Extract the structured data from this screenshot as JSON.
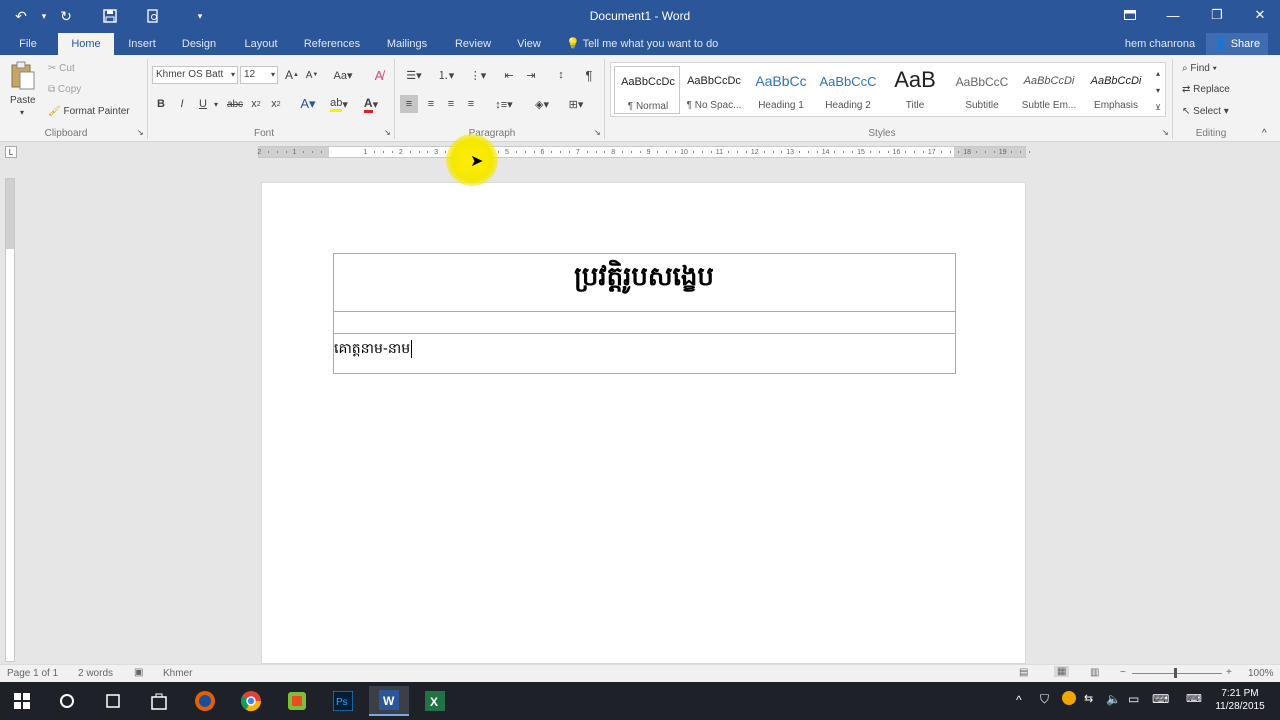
{
  "app": {
    "title": "Document1 - Word"
  },
  "tabs": [
    {
      "label": "File"
    },
    {
      "label": "Home"
    },
    {
      "label": "Insert"
    },
    {
      "label": "Design"
    },
    {
      "label": "Layout"
    },
    {
      "label": "References"
    },
    {
      "label": "Mailings"
    },
    {
      "label": "Review"
    },
    {
      "label": "View"
    }
  ],
  "tell_me": "Tell me what you want to do",
  "user": {
    "name": "hem chanrona",
    "share": "Share"
  },
  "clipboard": {
    "paste": "Paste",
    "cut": "Cut",
    "copy": "Copy",
    "format_painter": "Format Painter",
    "label": "Clipboard"
  },
  "font": {
    "name": "Khmer OS Batt",
    "size": "12",
    "label": "Font"
  },
  "paragraph": {
    "label": "Paragraph"
  },
  "styles": {
    "label": "Styles",
    "items": [
      {
        "sample": "AaBbCcDc",
        "name": "¶ Normal"
      },
      {
        "sample": "AaBbCcDc",
        "name": "¶ No Spac..."
      },
      {
        "sample": "AaBbCc",
        "name": "Heading 1"
      },
      {
        "sample": "AaBbCcC",
        "name": "Heading 2"
      },
      {
        "sample": "AaB",
        "name": "Title"
      },
      {
        "sample": "AaBbCcC",
        "name": "Subtitle"
      },
      {
        "sample": "AaBbCcDi",
        "name": "Subtle Em..."
      },
      {
        "sample": "AaBbCcDi",
        "name": "Emphasis"
      }
    ]
  },
  "editing": {
    "find": "Find",
    "replace": "Replace",
    "select": "Select",
    "label": "Editing"
  },
  "ruler": {
    "ticks": [
      "2",
      "1",
      "1",
      "2",
      "3",
      "4",
      "5",
      "6",
      "7",
      "8",
      "9",
      "10",
      "11",
      "12",
      "13",
      "14",
      "15",
      "16",
      "17",
      "18",
      "19"
    ]
  },
  "document": {
    "heading": "ប្រវត្តិរូបសង្ខេប",
    "field": "គោត្តនាម-នាម"
  },
  "status": {
    "page": "Page 1 of 1",
    "words": "2 words",
    "language": "Khmer",
    "zoom": "100%"
  },
  "taskbar": {
    "time": "7:21 PM",
    "date": "11/28/2015"
  },
  "colors": {
    "accent": "#2b579a",
    "highlight": "#ffee00"
  }
}
